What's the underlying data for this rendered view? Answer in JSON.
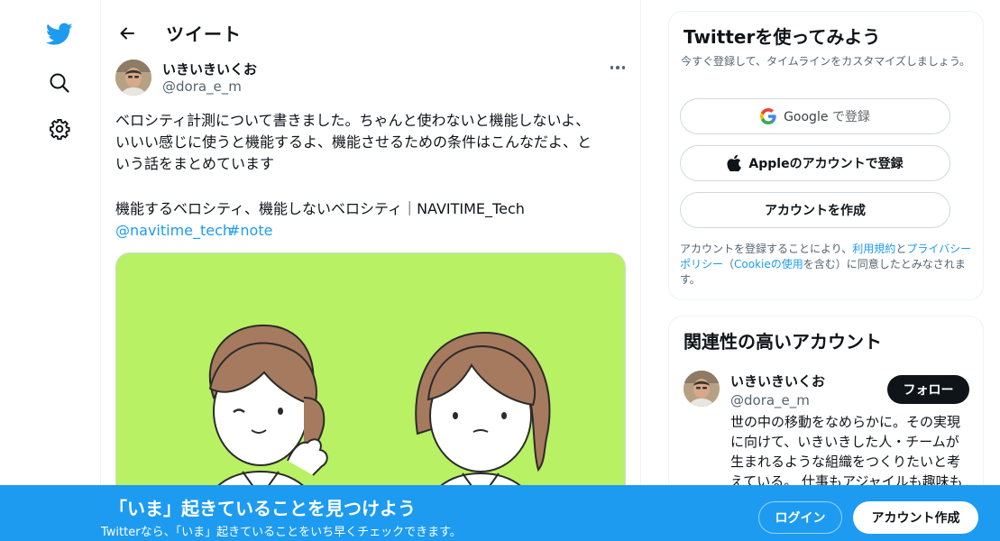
{
  "nav": {
    "icons": [
      "twitter-bird-icon",
      "search-icon",
      "gear-icon"
    ]
  },
  "header": {
    "title": "ツイート"
  },
  "tweet": {
    "author_name": "いきいきいくお",
    "author_handle": "@dora_e_m",
    "text_lines": [
      "ベロシティ計測について書きました。ちゃんと使わないと機能しないよ、",
      "いいい感じに使うと機能するよ、機能させるための条件はこんなだよ、と",
      "いう話をまとめています"
    ],
    "link_title": "機能するベロシティ、機能しないベロシティ｜NAVITIME_Tech",
    "mention": "@navitime_tech",
    "hashtag": "#note"
  },
  "signup": {
    "title": "Twitterを使ってみよう",
    "subtitle": "今すぐ登録して、タイムラインをカスタマイズしましょう。",
    "google_label": "Google",
    "google_suffix": "で登録",
    "apple_label": "Appleのアカウントで登録",
    "create_label": "アカウントを作成",
    "legal_1": "アカウントを登録することにより、",
    "terms_link": "利用規約",
    "legal_and": "と",
    "privacy_link": "プライバシーポリシー",
    "legal_paren_open": "（",
    "cookie_link": "Cookieの使用",
    "legal_2": "を含む）に同意したとみなされます。"
  },
  "related": {
    "title": "関連性の高いアカウント",
    "name": "いきいきいくお",
    "handle": "@dora_e_m",
    "follow_label": "フォロー",
    "bio": "世の中の移動をなめらかに。その実現に向けて、いきいきした人・チームが生まれるような組織をつくりたいと考えている。 仕事もアジャイルも趣味も"
  },
  "bottom_bar": {
    "title": "「いま」起きていることを見つけよう",
    "subtitle": "Twitterなら、「いま」起きていることをいち早くチェックできます。",
    "login_label": "ログイン",
    "signup_label": "アカウント作成"
  },
  "colors": {
    "accent": "#1d9bf0",
    "media_bg": "#b8f163",
    "text": "#0f1419",
    "muted": "#536471"
  }
}
